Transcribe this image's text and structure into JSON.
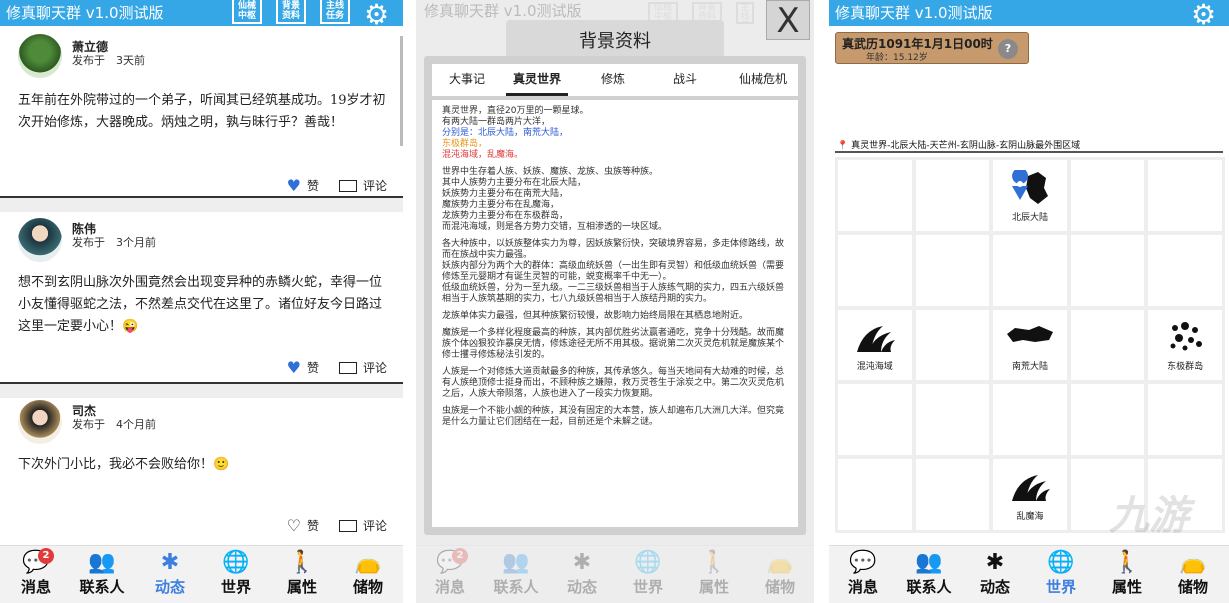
{
  "app": {
    "title": "修真聊天群 v1.0测试版"
  },
  "header_buttons": [
    "仙械中枢",
    "背景资料",
    "主线任务"
  ],
  "feed": [
    {
      "name": "萧立德",
      "time": "发布于　3天前",
      "text": "五年前在外院带过的一个弟子，听闻其已经筑基成功。19岁才初次开始修炼，大器晚成。炳烛之明，孰与昧行乎？善哉！",
      "liked": true
    },
    {
      "name": "陈伟",
      "time": "发布于　3个月前",
      "text": "想不到玄阴山脉次外围竟然会出现变异种的赤鳞火蛇，幸得一位小友懂得驱蛇之法，不然差点交代在这里了。诸位好友今日路过这里一定要小心！😜",
      "liked": true
    },
    {
      "name": "司杰",
      "time": "发布于　4个月前",
      "text": "下次外门小比，我必不会败给你！🙂",
      "liked": false
    }
  ],
  "actions": {
    "like": "赞",
    "comment": "评论"
  },
  "nav": {
    "items": [
      "消息",
      "联系人",
      "动态",
      "世界",
      "属性",
      "储物"
    ],
    "badge": "2"
  },
  "dialog": {
    "title": "背景资料",
    "close": "X",
    "tabs": [
      "大事记",
      "真灵世界",
      "修炼",
      "战斗",
      "仙械危机"
    ],
    "active_tab": "真灵世界",
    "paragraphs": [
      "真灵世界，直径20万里的一颗星球。",
      "有两大陆一群岛两片大洋，",
      "分别是：北辰大陆，南荒大陆，",
      "东极群岛，",
      "混沌海域，乱魔海。",
      "世界中生存着人族、妖族、魔族、龙族、虫族等种族。",
      "其中人族势力主要分布在北辰大陆，",
      "妖族势力主要分布在南荒大陆，",
      "魔族势力主要分布在乱魔海，",
      "龙族势力主要分布在东极群岛，",
      "而混沌海域，则是各方势力交错，互相渗透的一块区域。",
      "各大种族中，以妖族整体实力为尊，因妖族繁衍快，突破境界容易，多走体修路线，故而在族战中实力最强。",
      "妖族内部分为两个大的群体：高级血统妖兽（一出生即有灵智）和低级血统妖兽（需要修炼至元婴期才有诞生灵智的可能，蜕变概率千中无一）。",
      "低级血统妖兽，分为一至九级。一二三级妖兽相当于人族练气期的实力，四五六级妖兽相当于人族筑基期的实力，七八九级妖兽相当于人族结丹期的实力。",
      "龙族单体实力最强，但其种族繁衍较慢，故影响力始终局限在其栖息地附近。",
      "魔族是一个多样化程度最高的种族，其内部优胜劣汰赢者通吃，竞争十分残酷。故而魔族个体凶狠狡诈暴戾无情，修炼途径无所不用其极。据说第二次灭灵危机就是魔族某个修士攫寻修炼秘法引发的。",
      "人族是一个对修炼大道贡献最多的种族，其传承悠久。每当天地间有大劫难的时候，总有人族绝顶修士挺身而出，不顾种族之嫌隙，救万灵苍生于涂炭之中。第二次灭灵危机之后，人族大帝陨落，人族也进入了一段实力恢复期。",
      "虫族是一个不能小觑的种族，其没有固定的大本营，族人却遍布几大洲几大洋。但究竟是什么力量让它们团结在一起，目前还是个未解之谜。"
    ]
  },
  "world": {
    "date": "真武历1091年1月1日00时",
    "age": "年龄：15.12岁",
    "help": "?",
    "location": "真灵世界-北辰大陆-天芒州-玄阴山脉-玄阴山脉最外围区域",
    "map_labels": {
      "north": "北辰大陆",
      "chaos": "混沌海域",
      "south": "南荒大陆",
      "east": "东极群岛",
      "demon": "乱魔海"
    }
  },
  "colors": {
    "topbar": "#35a7e6",
    "accent": "#3d7fe0",
    "badge": "#e23b3b",
    "date_box": "#c79a6e"
  },
  "watermark": "九游"
}
